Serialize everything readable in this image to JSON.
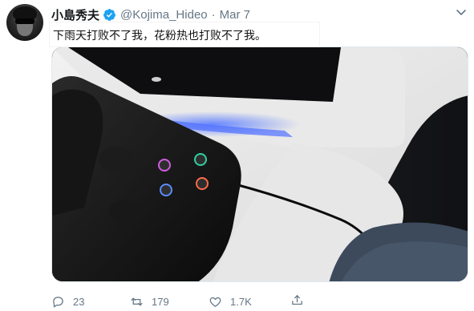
{
  "tweet": {
    "author_name": "小島秀夫",
    "handle": "@Kojima_Hideo",
    "separator": "·",
    "date": "Mar 7",
    "text": "下雨天打败不了我，花粉热也打败不了我。"
  },
  "actions": {
    "replies": "23",
    "retweets": "179",
    "likes": "1.7K"
  },
  "icons": {
    "verified": "verified-badge-icon",
    "caret": "chevron-down-icon",
    "reply": "reply-icon",
    "retweet": "retweet-icon",
    "like": "heart-icon",
    "share": "share-icon"
  },
  "colors": {
    "verified": "#1da1f2",
    "muted": "#657786"
  }
}
